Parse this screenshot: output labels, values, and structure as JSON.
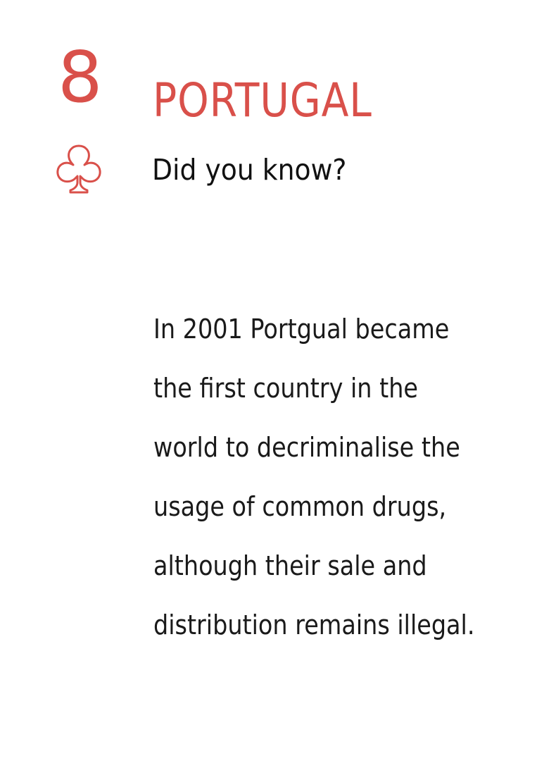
{
  "card": {
    "rank": "8",
    "country": "PORTUGAL",
    "suit_icon": "club-outline-icon",
    "subtitle": "Did you know?",
    "fact_lines": [
      "In 2001 Portgual became",
      "the first country in the",
      "world to decriminalise the",
      "usage of common drugs,",
      "although their sale and",
      "distribution remains illegal."
    ]
  },
  "colors": {
    "accent": "#d9504a",
    "text": "#1a1a1a",
    "background": "#ffffff"
  }
}
